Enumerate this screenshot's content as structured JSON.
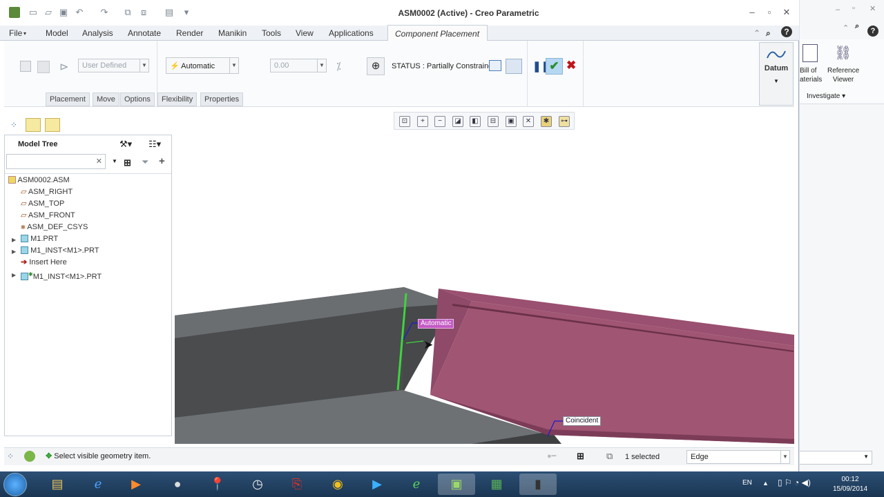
{
  "window": {
    "title": "ASM0002 (Active) - Creo Parametric"
  },
  "tabs": [
    "File",
    "Model",
    "Analysis",
    "Annotate",
    "Render",
    "Manikin",
    "Tools",
    "View",
    "Applications"
  ],
  "active_tab": "Component Placement",
  "ribbon": {
    "constraint_set": "User Defined",
    "constraint_type": "Automatic",
    "offset_value": "0.00",
    "status": "STATUS : Partially Constrained"
  },
  "subtabs": [
    "Placement",
    "Move",
    "Options",
    "Flexibility",
    "Properties"
  ],
  "datum_label": "Datum",
  "model_tree": {
    "title": "Model Tree",
    "items": [
      {
        "label": "ASM0002.ASM"
      },
      {
        "label": "ASM_RIGHT"
      },
      {
        "label": "ASM_TOP"
      },
      {
        "label": "ASM_FRONT"
      },
      {
        "label": "ASM_DEF_CSYS"
      },
      {
        "label": "M1.PRT"
      },
      {
        "label": "M1_INST<M1>.PRT"
      },
      {
        "label": "Insert Here"
      },
      {
        "label": "M1_INST<M1>.PRT"
      }
    ]
  },
  "graphics": {
    "tag_automatic": "Automatic",
    "tag_coincident": "Coincident"
  },
  "statusbar": {
    "message": "Select visible geometry item.",
    "selected": "1 selected",
    "filter": "Edge"
  },
  "side": {
    "bom_line1": "Bill of",
    "bom_line2": "aterials",
    "ref_line1": "Reference",
    "ref_line2": "Viewer",
    "investigate": "Investigate"
  },
  "taskbar": {
    "lang": "EN",
    "time": "00:12",
    "date": "15/09/2014"
  },
  "colors": {
    "part_gray": "#6b6e71",
    "part_pink": "#a05573",
    "ribbon_bg": "#fafbfc"
  }
}
